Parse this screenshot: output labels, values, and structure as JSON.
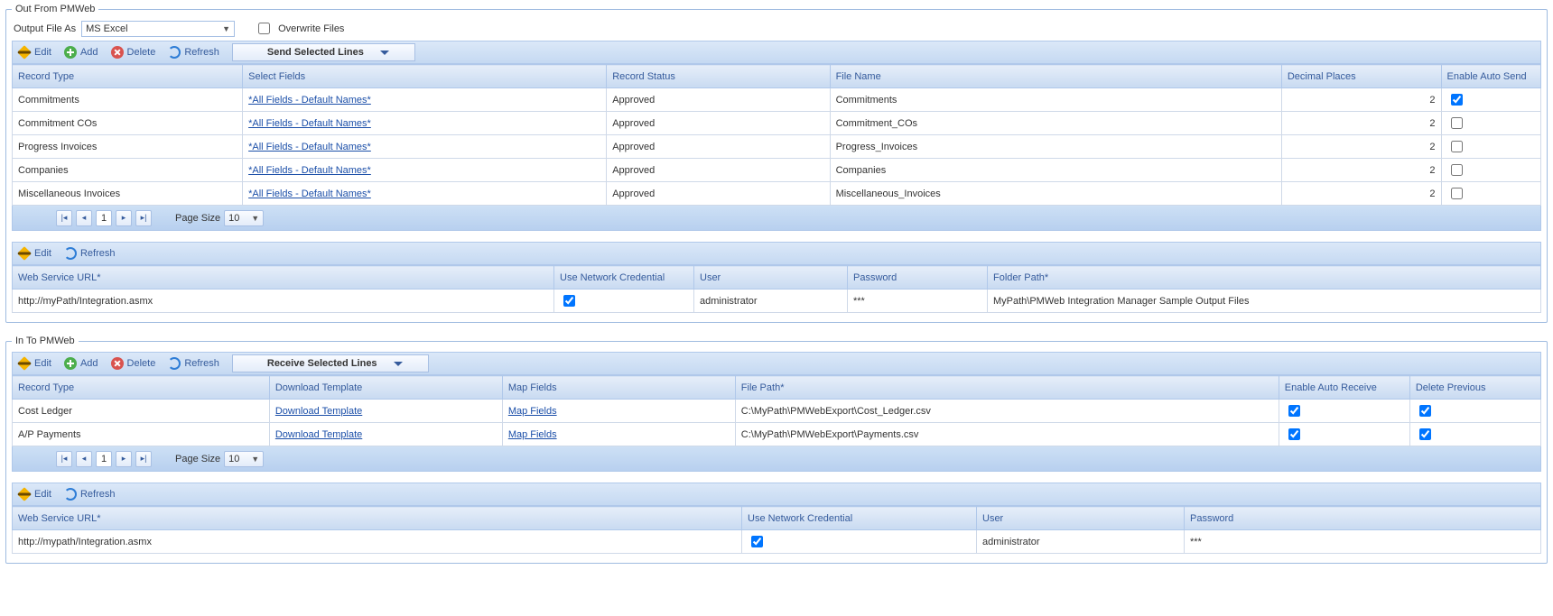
{
  "out": {
    "legend": "Out From PMWeb",
    "output_label": "Output File As",
    "output_value": "MS Excel",
    "overwrite_label": "Overwrite Files",
    "overwrite_checked": false,
    "toolbar": {
      "edit": "Edit",
      "add": "Add",
      "delete": "Delete",
      "refresh": "Refresh",
      "send": "Send Selected Lines"
    },
    "headers": {
      "record_type": "Record Type",
      "select_fields": "Select Fields",
      "record_status": "Record Status",
      "file_name": "File Name",
      "decimal_places": "Decimal Places",
      "enable_auto": "Enable Auto Send"
    },
    "rows": [
      {
        "record_type": "Commitments",
        "select_fields": "*All Fields - Default Names*",
        "record_status": "Approved",
        "file_name": "Commitments",
        "decimal_places": "2",
        "enable": true
      },
      {
        "record_type": "Commitment COs",
        "select_fields": "*All Fields - Default Names*",
        "record_status": "Approved",
        "file_name": "Commitment_COs",
        "decimal_places": "2",
        "enable": false
      },
      {
        "record_type": "Progress Invoices",
        "select_fields": "*All Fields - Default Names*",
        "record_status": "Approved",
        "file_name": "Progress_Invoices",
        "decimal_places": "2",
        "enable": false
      },
      {
        "record_type": "Companies",
        "select_fields": "*All Fields - Default Names*",
        "record_status": "Approved",
        "file_name": "Companies",
        "decimal_places": "2",
        "enable": false
      },
      {
        "record_type": "Miscellaneous Invoices",
        "select_fields": "*All Fields - Default Names*",
        "record_status": "Approved",
        "file_name": "Miscellaneous_Invoices",
        "decimal_places": "2",
        "enable": false
      }
    ],
    "pager": {
      "page": "1",
      "page_size_label": "Page Size",
      "page_size": "10"
    },
    "ws_toolbar": {
      "edit": "Edit",
      "refresh": "Refresh"
    },
    "ws_headers": {
      "url": "Web Service URL*",
      "use_cred": "Use Network Credential",
      "user": "User",
      "password": "Password",
      "folder": "Folder Path*"
    },
    "ws_row": {
      "url": "http://myPath/Integration.asmx",
      "use_cred": true,
      "user": "administrator",
      "password": "***",
      "folder": "MyPath\\PMWeb Integration Manager Sample Output Files"
    }
  },
  "in": {
    "legend": "In To PMWeb",
    "toolbar": {
      "edit": "Edit",
      "add": "Add",
      "delete": "Delete",
      "refresh": "Refresh",
      "receive": "Receive Selected Lines"
    },
    "headers": {
      "record_type": "Record Type",
      "download": "Download Template",
      "map": "Map Fields",
      "file_path": "File Path*",
      "enable": "Enable Auto Receive",
      "delete_prev": "Delete Previous"
    },
    "download_link_text": "Download Template",
    "map_link_text": "Map Fields",
    "rows": [
      {
        "record_type": "Cost Ledger",
        "file_path": "C:\\MyPath\\PMWebExport\\Cost_Ledger.csv",
        "enable": true,
        "delete_prev": true
      },
      {
        "record_type": "A/P Payments",
        "file_path": "C:\\MyPath\\PMWebExport\\Payments.csv",
        "enable": true,
        "delete_prev": true
      }
    ],
    "pager": {
      "page": "1",
      "page_size_label": "Page Size",
      "page_size": "10"
    },
    "ws_toolbar": {
      "edit": "Edit",
      "refresh": "Refresh"
    },
    "ws_headers": {
      "url": "Web Service URL*",
      "use_cred": "Use Network Credential",
      "user": "User",
      "password": "Password"
    },
    "ws_row": {
      "url": "http://mypath/Integration.asmx",
      "use_cred": true,
      "user": "administrator",
      "password": "***"
    }
  }
}
